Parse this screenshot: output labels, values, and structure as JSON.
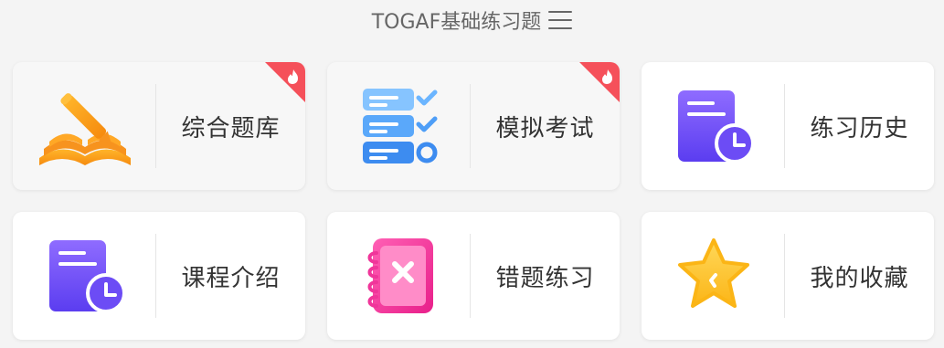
{
  "header": {
    "title": "TOGAF基础练习题"
  },
  "icons": {
    "menu": "menu-icon",
    "hot": "flame-icon"
  },
  "colors": {
    "hot_badge": "#f5505a",
    "orange": "#f7931e",
    "blue": "#3d8cf0",
    "purple": "#6c4cf5",
    "pink": "#f0359a",
    "gold": "#fbb516"
  },
  "cards": [
    {
      "label": "综合题库",
      "icon": "book-pen-icon",
      "hot": true
    },
    {
      "label": "模拟考试",
      "icon": "checklist-icon",
      "hot": true
    },
    {
      "label": "练习历史",
      "icon": "document-clock-icon",
      "hot": false
    },
    {
      "label": "课程介绍",
      "icon": "document-clock-icon",
      "hot": false
    },
    {
      "label": "错题练习",
      "icon": "notebook-x-icon",
      "hot": false
    },
    {
      "label": "我的收藏",
      "icon": "star-icon",
      "hot": false
    }
  ]
}
